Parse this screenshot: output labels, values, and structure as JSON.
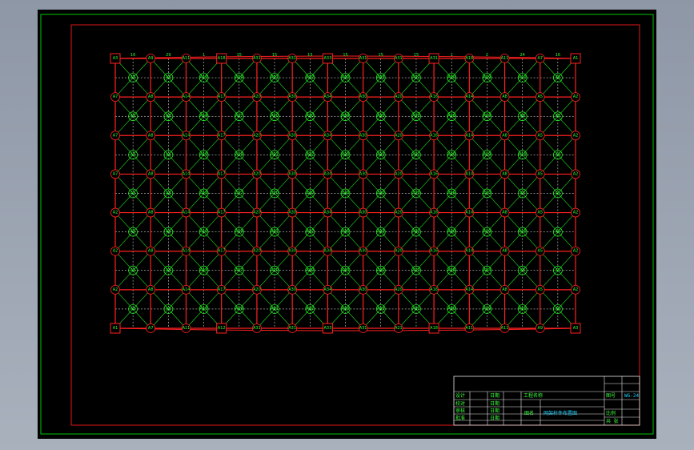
{
  "colors": {
    "background": "#000000",
    "border_outer": "#00c800",
    "frame": "#e01818",
    "grid_line": "#ff2020",
    "diagonal": "#20e020",
    "node": "#20ff20",
    "dashed": "#ffffff",
    "title_block": "#e8e8e8",
    "text_green": "#3cff3c",
    "text_cyan": "#23d2ff"
  },
  "grid": {
    "columns": 13,
    "rows": 7,
    "top_node_labels": [
      "A3",
      "A9",
      "A11",
      "A18",
      "A31",
      "A31",
      "A33",
      "A31",
      "A31",
      "A31",
      "A18",
      "A11",
      "A7",
      "A1"
    ],
    "bottom_node_labels": [
      "A1",
      "A7",
      "A11",
      "A12",
      "A31",
      "A31",
      "A33",
      "A31",
      "A21",
      "A18",
      "A11",
      "A11",
      "A9",
      "A3"
    ],
    "left_node_labels": [
      "A3",
      "A7",
      "A7",
      "A7",
      "A2",
      "A2",
      "A2",
      "A1"
    ],
    "right_node_labels": [
      "A1",
      "A2",
      "A2",
      "A2",
      "A2",
      "A2",
      "A2",
      "A3"
    ],
    "center_node_labels": [
      "A5",
      "A6",
      "A10",
      "A19",
      "A31",
      "A32",
      "A30",
      "A33",
      "A31",
      "A30",
      "A19",
      "A10",
      "A6"
    ],
    "mid_row_labels": [
      "A5",
      "A8",
      "A14",
      "A17",
      "A20",
      "A30",
      "A34",
      "A30",
      "A20",
      "A16",
      "A14",
      "A8",
      "A5"
    ],
    "edge_dim_labels": [
      "16",
      "29",
      "1",
      "15",
      "15",
      "13",
      "15",
      "15",
      "15",
      "1",
      "2",
      "24"
    ],
    "square_nodes": [
      {
        "col": 0,
        "row": 0
      },
      {
        "col": 3,
        "row": 0
      },
      {
        "col": 6,
        "row": 0
      },
      {
        "col": 9,
        "row": 0
      },
      {
        "col": 13,
        "row": 0
      },
      {
        "col": 0,
        "row": 7
      },
      {
        "col": 3,
        "row": 7
      },
      {
        "col": 6,
        "row": 7
      },
      {
        "col": 9,
        "row": 7
      },
      {
        "col": 13,
        "row": 7
      }
    ]
  },
  "title_block": {
    "drawing_code_label": "图号",
    "drawing_code": "WG-24",
    "scale_label": "比例",
    "sheet_label": "共 张",
    "rows": [
      {
        "c1": "设计",
        "c2": "日期",
        "c3": "工程名称"
      },
      {
        "c1": "校对",
        "c2": "日期",
        "c3": ""
      },
      {
        "c1": "审核",
        "c2": "日期",
        "c3": "图名"
      },
      {
        "c1": "批准",
        "c2": "日期",
        "c3": "网架杆件布置图"
      }
    ],
    "project_name_short": "工程名称",
    "drawing_title": "网架杆件布置图"
  }
}
